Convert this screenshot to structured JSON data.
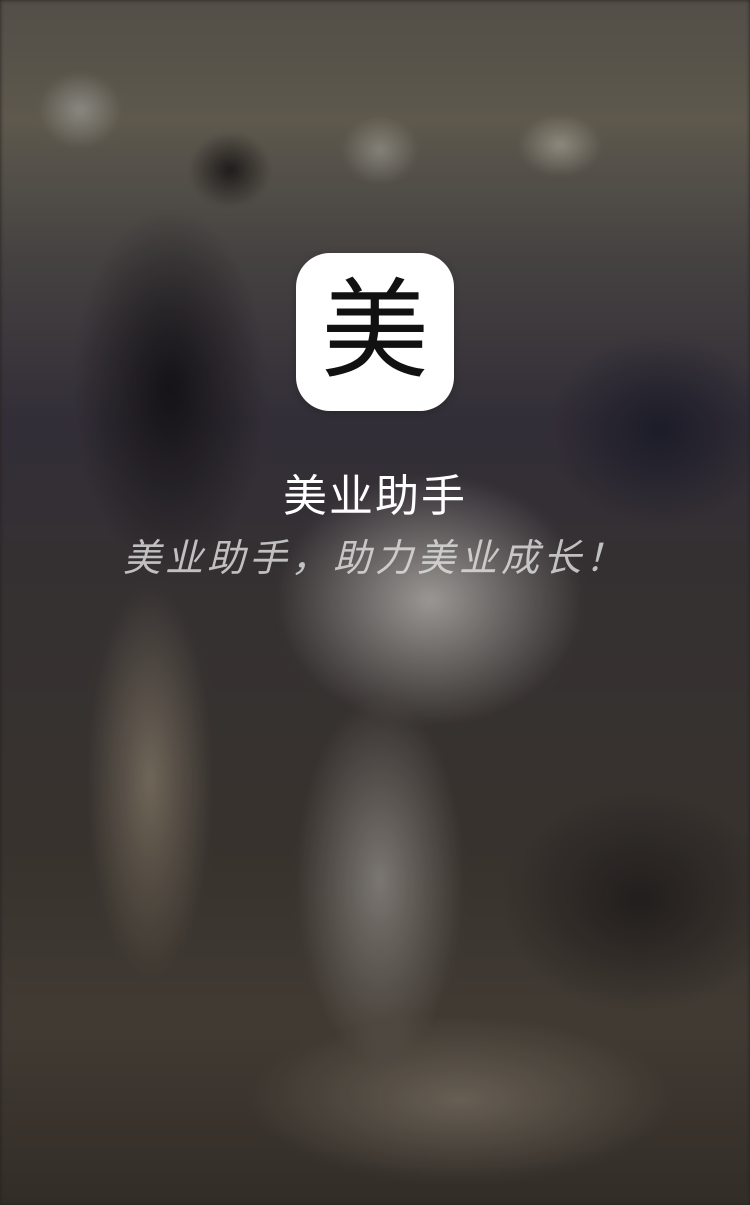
{
  "background": {
    "description_icon": "barbershop-photo-background"
  },
  "app_icon": {
    "glyph": "美",
    "icon_name": "mei-app-logo-icon",
    "background_color": "#ffffff",
    "glyph_color": "#111111"
  },
  "app_title": "美业助手",
  "slogan": "美业助手，助力美业成长！"
}
